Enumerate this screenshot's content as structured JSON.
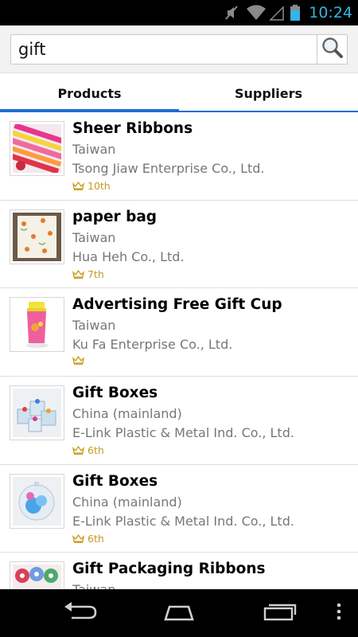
{
  "status_bar": {
    "time": "10:24"
  },
  "search": {
    "query": "gift"
  },
  "tabs": [
    {
      "label": "Products",
      "active": true
    },
    {
      "label": "Suppliers",
      "active": false
    }
  ],
  "accent_color": "#1f6fcf",
  "rank_color": "#c99a1e",
  "products": [
    {
      "title": "Sheer Ribbons",
      "country": "Taiwan",
      "company": "Tsong Jiaw Enterprise Co., Ltd.",
      "rank": "10th",
      "image": "ribbons-thumbnail"
    },
    {
      "title": "paper bag",
      "country": "Taiwan",
      "company": "Hua Heh Co., Ltd.",
      "rank": "7th",
      "image": "paper-bag-thumbnail"
    },
    {
      "title": "Advertising Free Gift Cup",
      "country": "Taiwan",
      "company": "Ku Fa Enterprise Co., Ltd.",
      "rank": "",
      "image": "cup-thumbnail"
    },
    {
      "title": "Gift Boxes",
      "country": "China (mainland)",
      "company": "E-Link Plastic & Metal Ind. Co., Ltd.",
      "rank": "6th",
      "image": "gift-boxes-thumbnail"
    },
    {
      "title": "Gift Boxes",
      "country": "China (mainland)",
      "company": "E-Link Plastic & Metal Ind. Co., Ltd.",
      "rank": "6th",
      "image": "gift-ball-thumbnail"
    },
    {
      "title": "Gift Packaging Ribbons",
      "country": "Taiwan",
      "company": "",
      "rank": "",
      "image": "ribbon-spools-thumbnail"
    }
  ]
}
